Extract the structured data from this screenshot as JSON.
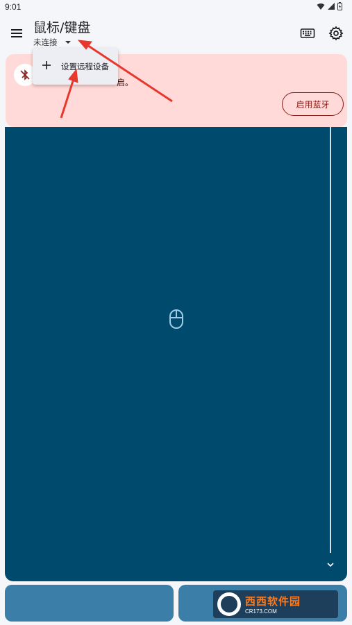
{
  "status_bar": {
    "time": "9:01"
  },
  "app_bar": {
    "title": "鼠标/键盘",
    "connection_status": "未连接",
    "menu_icon": "hamburger-menu-icon",
    "keyboard_icon": "keyboard-icon",
    "settings_icon": "gear-icon"
  },
  "dropdown": {
    "items": [
      {
        "label": "设置远程设备",
        "icon": "plus-icon"
      }
    ]
  },
  "bluetooth_card": {
    "icon": "bluetooth-disabled-icon",
    "message_visible": "启。",
    "button_label": "启用蓝牙"
  },
  "touchpad": {
    "icon": "mouse-icon",
    "scroll_icon": "chevron-down-icon"
  },
  "watermark": {
    "brand": "西西软件园",
    "site": "CR173.COM"
  },
  "colors": {
    "background": "#f4f6fa",
    "touchpad": "#004a6e",
    "card": "#ffdad8",
    "accent_red": "#8c1d18",
    "mouse_buttons": "#3b7fa9",
    "arrow": "#e8372c"
  }
}
